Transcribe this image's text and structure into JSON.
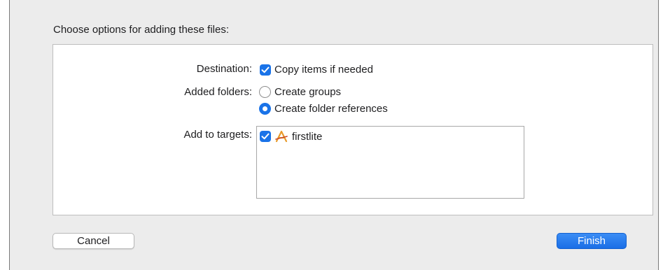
{
  "dialog": {
    "heading": "Choose options for adding these files:",
    "destination": {
      "label": "Destination:",
      "option": "Copy items if needed",
      "checked": true
    },
    "added_folders": {
      "label": "Added folders:",
      "options": [
        {
          "label": "Create groups",
          "selected": false
        },
        {
          "label": "Create folder references",
          "selected": true
        }
      ]
    },
    "targets": {
      "label": "Add to targets:",
      "items": [
        {
          "name": "firstlite",
          "checked": true,
          "icon": "app-target-icon"
        }
      ]
    },
    "buttons": {
      "cancel": "Cancel",
      "finish": "Finish"
    },
    "colors": {
      "accent": "#1a73e8",
      "background": "#ececec"
    }
  }
}
